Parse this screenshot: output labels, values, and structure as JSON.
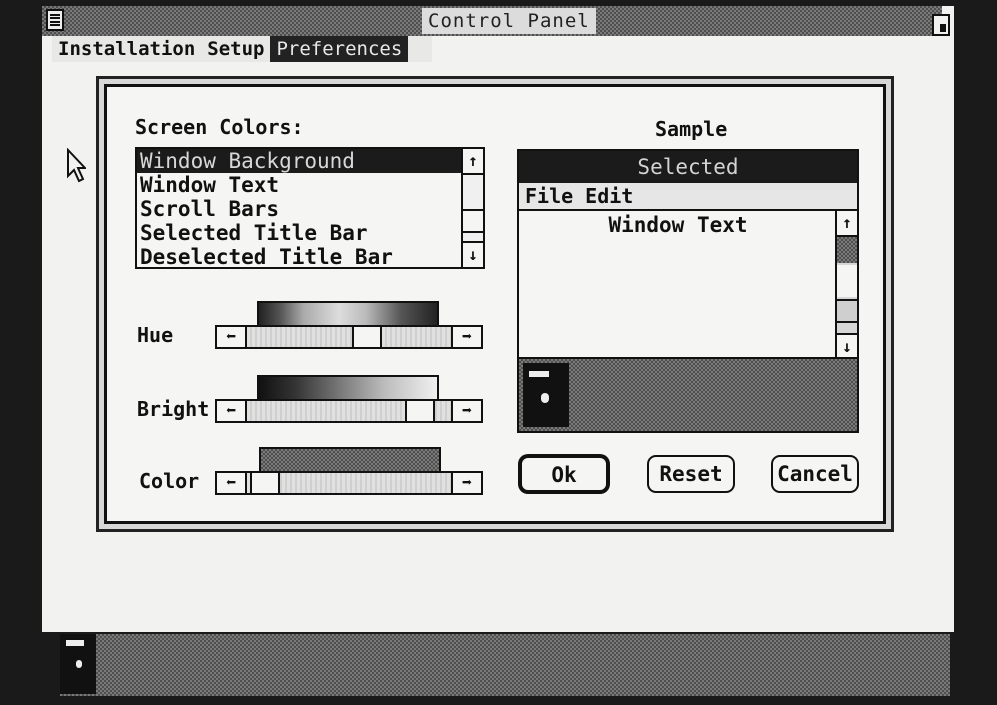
{
  "window": {
    "title": "Control Panel"
  },
  "menubar": {
    "items": [
      "Installation",
      "Setup",
      "Preferences"
    ]
  },
  "dialog": {
    "screen_colors_label": "Screen Colors:",
    "color_items": [
      "Window Background",
      "Window Text",
      "Scroll Bars",
      "Selected Title Bar",
      "Deselected Title Bar"
    ],
    "selected_color_index": 0,
    "sliders": {
      "hue_label": "Hue",
      "bright_label": "Bright",
      "color_label": "Color",
      "hue_position": 0.6,
      "bright_position": 0.9,
      "color_position": 0.03
    },
    "sample": {
      "label": "Sample",
      "title": "Selected",
      "menu": [
        "File",
        "Edit"
      ],
      "window_text": "Window Text"
    },
    "buttons": {
      "ok": "Ok",
      "reset": "Reset",
      "cancel": "Cancel"
    }
  },
  "icons": [
    "system-menu-icon",
    "maximize-icon",
    "arrow-cursor-icon",
    "up-arrow-icon",
    "down-arrow-icon",
    "left-arrow-icon",
    "right-arrow-icon",
    "app-icon"
  ]
}
